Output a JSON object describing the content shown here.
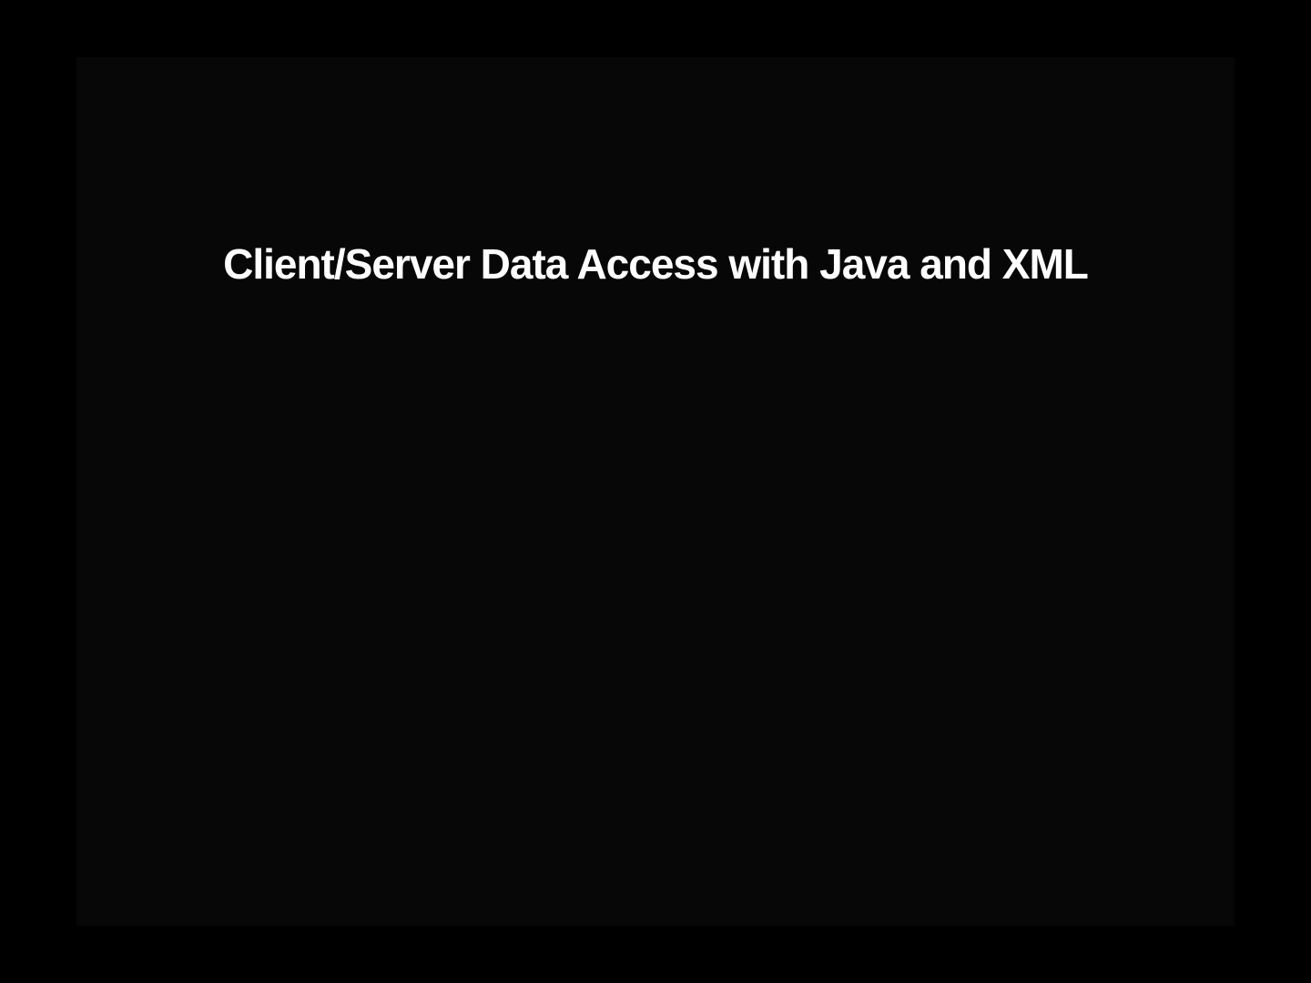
{
  "slide": {
    "title": "Client/Server Data Access with Java and XML"
  }
}
